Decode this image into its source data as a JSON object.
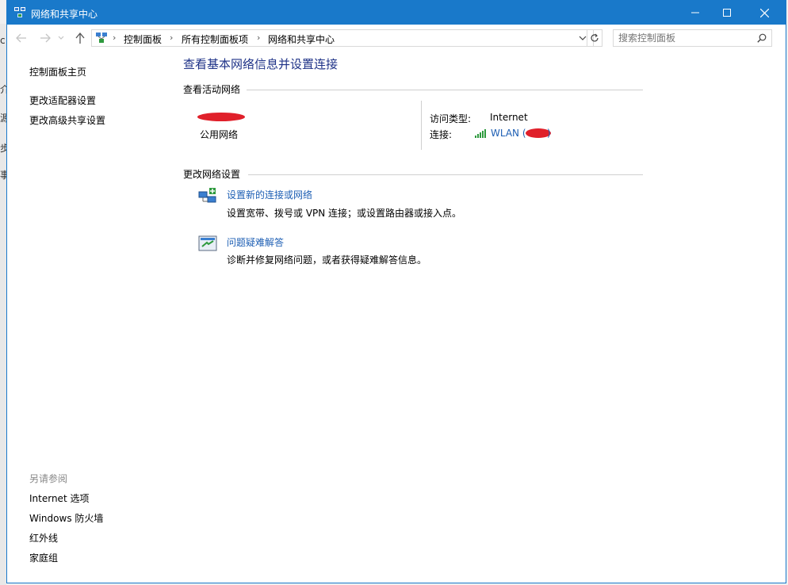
{
  "window": {
    "title": "网络和共享中心"
  },
  "address": {
    "breadcrumbs": [
      "控制面板",
      "所有控制面板项",
      "网络和共享中心"
    ],
    "search_placeholder": "搜索控制面板"
  },
  "sidebar": {
    "home": "控制面板主页",
    "items": [
      "更改适配器设置",
      "更改高级共享设置"
    ],
    "see_also_title": "另请参阅",
    "see_also": [
      "Internet 选项",
      "Windows 防火墙",
      "红外线",
      "家庭组"
    ]
  },
  "main": {
    "title": "查看基本网络信息并设置连接",
    "active_section": "查看活动网络",
    "network_type": "公用网络",
    "access_type_label": "访问类型:",
    "access_type_value": "Internet",
    "connection_label": "连接:",
    "connection_name": "WLAN",
    "connection_open_paren": "(",
    "connection_close_paren": ")",
    "change_section": "更改网络设置",
    "tasks": [
      {
        "title": "设置新的连接或网络",
        "desc": "设置宽带、拨号或 VPN 连接；或设置路由器或接入点。"
      },
      {
        "title": "问题疑难解答",
        "desc": "诊断并修复网络问题，或者获得疑难解答信息。"
      }
    ]
  },
  "background_window_fragments": [
    "c",
    "介",
    "源",
    "步",
    "事"
  ],
  "colors": {
    "titlebar": "#1979ca",
    "link": "#1e5fb4",
    "heading": "#1e3287",
    "redaction": "#e0202a"
  }
}
